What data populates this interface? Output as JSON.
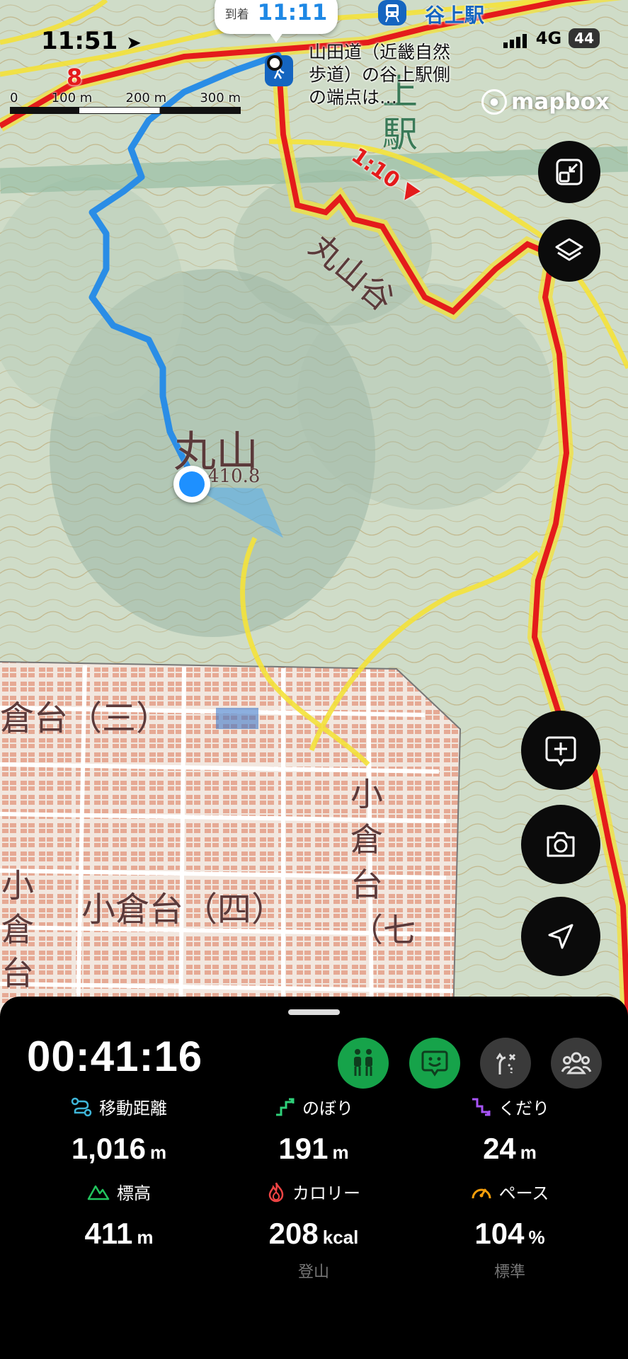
{
  "status_bar": {
    "time": "11:51",
    "network": "4G",
    "battery": "44"
  },
  "arrival": {
    "label": "到着",
    "time": "11:11"
  },
  "station": {
    "name": "谷上駅"
  },
  "poi": {
    "label": "山田道（近畿自然歩道）の谷上駅側の端点は…"
  },
  "route_marks": {
    "number": "8",
    "time": "1:10"
  },
  "map_labels": {
    "mountain": "丸山",
    "elevation": "410.8",
    "valley": "丸山谷",
    "station_vertical": "上駅",
    "district_3": "倉台（三）",
    "district_4": "小倉台（四）",
    "district_7": "小倉台（七",
    "district_left": "小倉台"
  },
  "attribution": "mapbox",
  "scale": {
    "ticks": [
      "0",
      "100 m",
      "200 m",
      "300 m"
    ]
  },
  "colors": {
    "route_red": "#e41b1b",
    "track_blue": "#2a8de6",
    "trail_yellow": "#f4e23a",
    "location_blue": "#1e90ff"
  },
  "map_controls": [
    {
      "name": "fit-bounds",
      "icon": "collapse-icon"
    },
    {
      "name": "layers",
      "icon": "layers-icon"
    },
    {
      "name": "add-note",
      "icon": "plus-bubble-icon"
    },
    {
      "name": "camera",
      "icon": "camera-icon"
    },
    {
      "name": "locate",
      "icon": "navigation-arrow-icon"
    }
  ],
  "activity": {
    "elapsed": "00:41:16",
    "modes": [
      {
        "name": "hiking-buddies",
        "icon": "people-pair-icon",
        "active": true,
        "color": "#16a34a"
      },
      {
        "name": "face-status",
        "icon": "smile-bubble-icon",
        "active": true,
        "color": "#16a34a"
      },
      {
        "name": "route-deviation",
        "icon": "route-branch-icon",
        "active": false
      },
      {
        "name": "group",
        "icon": "group-icon",
        "active": false
      }
    ],
    "stats": [
      {
        "label": "移動距離",
        "icon": "distance-icon",
        "color": "#3fb6d9",
        "value": "1,016",
        "unit": "m",
        "sub": ""
      },
      {
        "label": "のぼり",
        "icon": "ascent-icon",
        "color": "#2fd17a",
        "value": "191",
        "unit": "m",
        "sub": ""
      },
      {
        "label": "くだり",
        "icon": "descent-icon",
        "color": "#a855f7",
        "value": "24",
        "unit": "m",
        "sub": ""
      },
      {
        "label": "標高",
        "icon": "mountain-icon",
        "color": "#22c55e",
        "value": "411",
        "unit": "m",
        "sub": ""
      },
      {
        "label": "カロリー",
        "icon": "flame-icon",
        "color": "#ef4444",
        "value": "208",
        "unit": "kcal",
        "sub": "登山"
      },
      {
        "label": "ペース",
        "icon": "gauge-icon",
        "color": "#f59e0b",
        "value": "104",
        "unit": "%",
        "sub": "標準"
      }
    ]
  }
}
